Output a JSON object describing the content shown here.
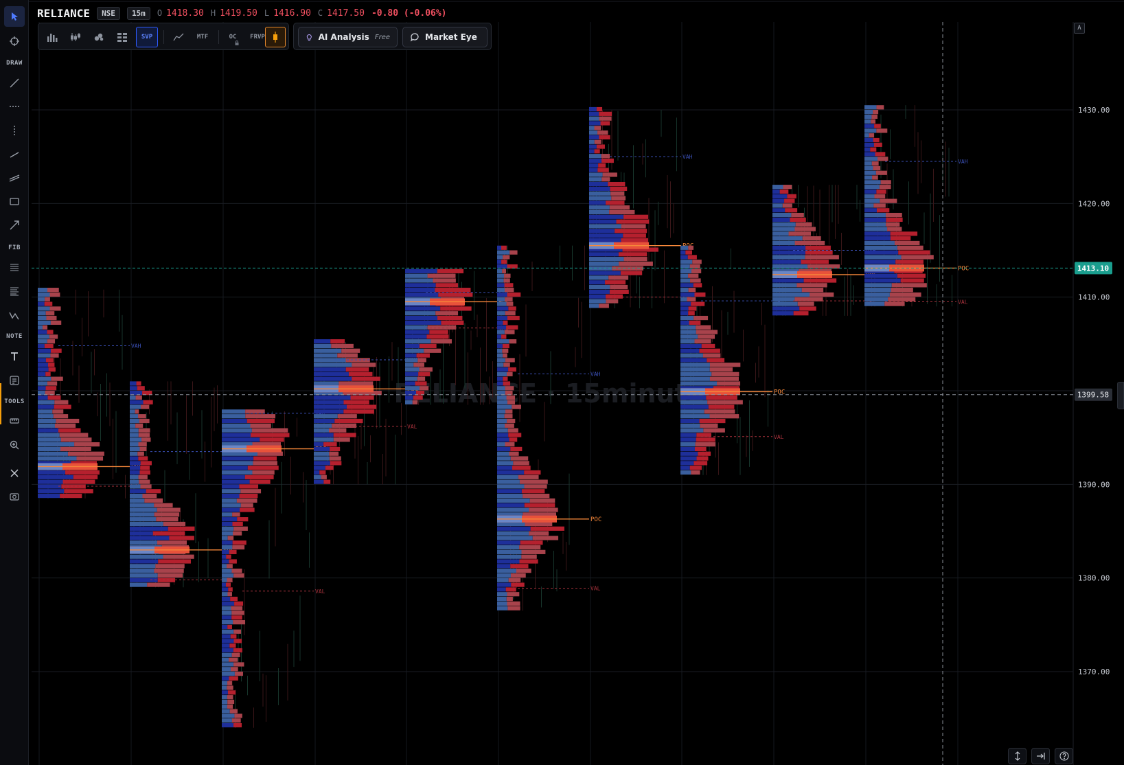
{
  "header": {
    "symbol": "RELIANCE",
    "exchange": "NSE",
    "interval": "15m",
    "open_label": "O",
    "open": "1418.30",
    "high_label": "H",
    "high": "1419.50",
    "low_label": "L",
    "low": "1416.90",
    "close_label": "C",
    "close": "1417.50",
    "change": "-0.80 (-0.06%)",
    "change_color": "#f05060"
  },
  "left_toolbar": {
    "sections": {
      "draw": "DRAW",
      "fib": "FIB",
      "note": "NOTE",
      "tools": "TOOLS"
    },
    "icons": [
      "cursor-icon",
      "crosshair-icon",
      "trend-line-icon",
      "horizontal-line-icon",
      "vertical-line-icon",
      "ray-icon",
      "parallel-channel-icon",
      "rectangle-icon",
      "arrow-icon",
      "fib-retracement-icon",
      "fib-extension-icon",
      "zigzag-icon",
      "text-icon",
      "note-icon",
      "measure-icon",
      "zoom-icon",
      "remove-drawings-icon",
      "screenshot-icon"
    ]
  },
  "chart_toolbar": {
    "svp": "SVP",
    "mtf": "MTF",
    "oc": "OC",
    "frvp": "FRVP"
  },
  "ai": {
    "ai_label": "AI Analysis",
    "ai_free": "Free",
    "market_eye": "Market Eye"
  },
  "axis": {
    "autoscale": "A",
    "ticks": [
      "1430.00",
      "1420.00",
      "1410.00",
      "1390.00",
      "1380.00",
      "1370.00"
    ],
    "current_price": "1413.10",
    "crosshair_price": "1399.58"
  },
  "watermark": "RELIANCE · 15minute",
  "colors": {
    "background": "#000000",
    "buy_volume": "#3a5f9e",
    "buy_volume_strong": "#1e2f9a",
    "sell_volume": "#a8434c",
    "sell_volume_strong": "#b5202e",
    "poc": "#f5873a",
    "vah": "#3a4fb5",
    "val": "#a8323c",
    "current_price": "#1a9e8e"
  },
  "chart_data": {
    "type": "volume-profile",
    "y_range": [
      1362,
      1436
    ],
    "level_labels": {
      "poc": "POC",
      "vah": "VAH",
      "val": "VAL"
    },
    "sessions": [
      {
        "high": 1410.8,
        "low": 1388.5,
        "poc": 1391.9,
        "vah": 1404.8,
        "val": 1389.8
      },
      {
        "high": 1401.0,
        "low": 1379.0,
        "poc": 1383.0,
        "vah": 1393.5,
        "val": 1379.8
      },
      {
        "high": 1397.8,
        "low": 1364.0,
        "poc": 1393.8,
        "vah": 1397.6,
        "val": 1378.6
      },
      {
        "high": 1405.2,
        "low": 1390.0,
        "poc": 1400.2,
        "vah": 1403.3,
        "val": 1396.2
      },
      {
        "high": 1412.8,
        "low": 1398.5,
        "poc": 1409.5,
        "vah": 1410.5,
        "val": 1406.7
      },
      {
        "high": 1415.5,
        "low": 1376.5,
        "poc": 1386.3,
        "vah": 1401.8,
        "val": 1378.9
      },
      {
        "high": 1430.0,
        "low": 1408.8,
        "poc": 1415.5,
        "vah": 1425.0,
        "val": 1410.0
      },
      {
        "high": 1415.2,
        "low": 1391.0,
        "poc": 1399.9,
        "vah": 1409.6,
        "val": 1395.1
      },
      {
        "high": 1422.0,
        "low": 1408.0,
        "poc": 1412.4,
        "vah": 1415.0,
        "val": 1409.6
      },
      {
        "high": 1430.5,
        "low": 1409.0,
        "poc": 1413.1,
        "vah": 1424.5,
        "val": 1409.5
      }
    ]
  }
}
